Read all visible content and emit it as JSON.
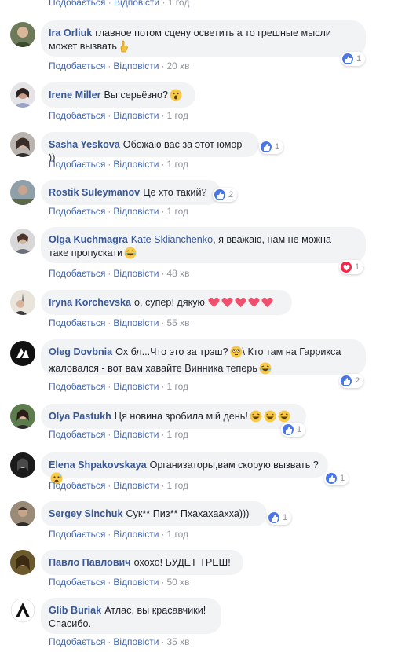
{
  "top_actions": {
    "like": "Подобається",
    "reply": "Відповісти",
    "time": "1 год"
  },
  "comments": [
    {
      "author": "Ira Orliuk",
      "text_line1": "главное потом сцену осветить а то грешные мысли",
      "text_line2": "может вызвать",
      "like": "Подобається",
      "reply": "Відповісти",
      "time": "20 хв",
      "reaction_count": "1",
      "reaction": "like-icon"
    },
    {
      "author": "Irene Miller",
      "text": "Вы серьёзно?",
      "like": "Подобається",
      "reply": "Відповісти",
      "time": "1 год"
    },
    {
      "author": "Sasha Yeskova",
      "text": "Обожаю вас за этот юмор ))",
      "like": "Подобається",
      "reply": "Відповісти",
      "time": "1 год",
      "reaction_count": "1",
      "reaction": "like-icon"
    },
    {
      "author": "Rostik Suleymanov",
      "text": "Це хто такий?",
      "like": "Подобається",
      "reply": "Відповісти",
      "time": "1 год",
      "reaction_count": "2",
      "reaction": "like-icon"
    },
    {
      "author": "Olga Kuchmagra",
      "mention": "Kate Sklianchenko",
      "text_line1": ", я вважаю, нам не можна",
      "text_line2": "таке пропускати",
      "like": "Подобається",
      "reply": "Відповісти",
      "time": "48 хв",
      "reaction_count": "1",
      "reaction": "love-icon"
    },
    {
      "author": "Iryna Korchevska",
      "text": "о, супер! дякую",
      "like": "Подобається",
      "reply": "Відповісти",
      "time": "55 хв"
    },
    {
      "author": "Oleg Dovbnia",
      "text_line1": "Ох бл...Что это за трэш?",
      "text_line1b": "\\ Кто там на Гаррикса",
      "text_line2": "жаловался - вот вам хавайте Винника теперь",
      "like": "Подобається",
      "reply": "Відповісти",
      "time": "1 год",
      "reaction_count": "2",
      "reaction": "like-icon"
    },
    {
      "author": "Olya Pastukh",
      "text": "Ця новина зробила мій день!",
      "like": "Подобається",
      "reply": "Відповісти",
      "time": "1 год",
      "reaction_count": "1",
      "reaction": "like-icon"
    },
    {
      "author": "Elena Shpakovskaya",
      "text": "Организаторы,вам скорую вызвать ?",
      "like": "Подобається",
      "reply": "Відповісти",
      "time": "1 год",
      "reaction_count": "1",
      "reaction": "like-icon"
    },
    {
      "author": "Sergey Sinchuk",
      "text": "Сук** Пиз** Пхахахаахха)))",
      "like": "Подобається",
      "reply": "Відповісти",
      "time": "1 год",
      "reaction_count": "1",
      "reaction": "like-icon"
    },
    {
      "author": "Павло Павлович",
      "text": "охохо! БУДЕТ ТРЕШ!",
      "like": "Подобається",
      "reply": "Відповісти",
      "time": "50 хв"
    },
    {
      "author": "Glib Buriak",
      "text_line1": "Атлас, вы красавчики!",
      "text_line2": "Спасибо.",
      "like": "Подобається",
      "reply": "Відповісти",
      "time": "35 хв"
    }
  ],
  "colors": {
    "link": "#385898",
    "action_link": "#4267b2",
    "bubble": "#f2f3f5",
    "like": "#4a76e8",
    "love": "#f0284a"
  }
}
